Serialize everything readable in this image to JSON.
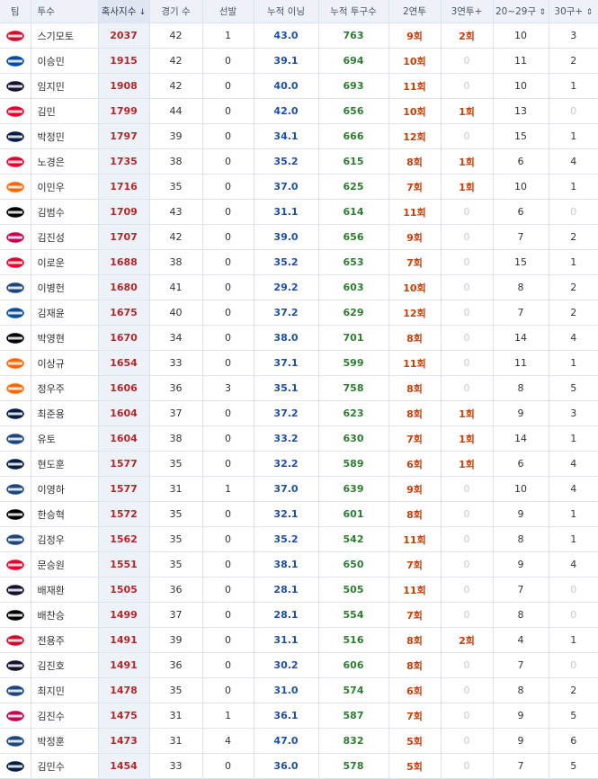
{
  "headers": [
    "팀",
    "투수",
    "혹사지수",
    "경기 수",
    "선발",
    "누적 이닝",
    "누적 투구수",
    "2연투",
    "3연투+",
    "20~29구",
    "30구+"
  ],
  "sort_arrow": "↓",
  "sortable_arrow": "⇕",
  "team_colors": {
    "SSG": "#ce0e2d",
    "LG": "#c30452",
    "NC": "#1d467f",
    "KIA": "#ea0029",
    "DOO": "#131230",
    "LOT": "#041e42",
    "HAN": "#ff6600",
    "KT": "#000000",
    "SAM": "#074ca1",
    "KIW": "#820024"
  },
  "rows": [
    {
      "team": "SSG",
      "team_label": "SSG",
      "pitcher": "스기모토",
      "strain": "2037",
      "games": "42",
      "starts": "1",
      "innings": "43.0",
      "pitches": "763",
      "two": "9회",
      "three": "2회",
      "r2029": "10",
      "r30": "3"
    },
    {
      "team": "SAM",
      "team_label": "LIONS",
      "pitcher": "이승민",
      "strain": "1915",
      "games": "42",
      "starts": "0",
      "innings": "39.1",
      "pitches": "694",
      "two": "10회",
      "three": "0",
      "r2029": "11",
      "r30": "2"
    },
    {
      "team": "DOO",
      "team_label": "TWINS",
      "pitcher": "임지민",
      "strain": "1908",
      "games": "42",
      "starts": "0",
      "innings": "40.0",
      "pitches": "693",
      "two": "11회",
      "three": "0",
      "r2029": "10",
      "r30": "1"
    },
    {
      "team": "KIA",
      "team_label": "TIGERS",
      "pitcher": "김민",
      "strain": "1799",
      "games": "44",
      "starts": "0",
      "innings": "42.0",
      "pitches": "656",
      "two": "10회",
      "three": "1회",
      "r2029": "13",
      "r30": "0"
    },
    {
      "team": "LOT",
      "team_label": "GIANTS",
      "pitcher": "박정민",
      "strain": "1797",
      "games": "39",
      "starts": "0",
      "innings": "34.1",
      "pitches": "666",
      "two": "12회",
      "three": "0",
      "r2029": "15",
      "r30": "1"
    },
    {
      "team": "KIA",
      "team_label": "TIGERS",
      "pitcher": "노경은",
      "strain": "1735",
      "games": "38",
      "starts": "0",
      "innings": "35.2",
      "pitches": "615",
      "two": "8회",
      "three": "1회",
      "r2029": "6",
      "r30": "4"
    },
    {
      "team": "HAN",
      "team_label": "EAGLES",
      "pitcher": "이민우",
      "strain": "1716",
      "games": "35",
      "starts": "0",
      "innings": "37.0",
      "pitches": "625",
      "two": "7회",
      "three": "1회",
      "r2029": "10",
      "r30": "1"
    },
    {
      "team": "KT",
      "team_label": "KT",
      "pitcher": "김범수",
      "strain": "1709",
      "games": "43",
      "starts": "0",
      "innings": "31.1",
      "pitches": "614",
      "two": "11회",
      "three": "0",
      "r2029": "6",
      "r30": "0"
    },
    {
      "team": "LG",
      "team_label": "TWINS",
      "pitcher": "김진성",
      "strain": "1707",
      "games": "42",
      "starts": "0",
      "innings": "39.0",
      "pitches": "656",
      "two": "9회",
      "three": "0",
      "r2029": "7",
      "r30": "2"
    },
    {
      "team": "KIA",
      "team_label": "TIGERS",
      "pitcher": "이로운",
      "strain": "1688",
      "games": "38",
      "starts": "0",
      "innings": "35.2",
      "pitches": "653",
      "two": "7회",
      "three": "0",
      "r2029": "15",
      "r30": "1"
    },
    {
      "team": "NC",
      "team_label": "DINOS",
      "pitcher": "이병헌",
      "strain": "1680",
      "games": "41",
      "starts": "0",
      "innings": "29.2",
      "pitches": "603",
      "two": "10회",
      "three": "0",
      "r2029": "8",
      "r30": "2"
    },
    {
      "team": "SAM",
      "team_label": "LIONS",
      "pitcher": "김재윤",
      "strain": "1675",
      "games": "40",
      "starts": "0",
      "innings": "37.2",
      "pitches": "629",
      "two": "12회",
      "three": "0",
      "r2029": "7",
      "r30": "2"
    },
    {
      "team": "KT",
      "team_label": "KT",
      "pitcher": "박영현",
      "strain": "1670",
      "games": "34",
      "starts": "0",
      "innings": "38.0",
      "pitches": "701",
      "two": "8회",
      "three": "0",
      "r2029": "14",
      "r30": "4"
    },
    {
      "team": "HAN",
      "team_label": "EAGLES",
      "pitcher": "이상규",
      "strain": "1654",
      "games": "33",
      "starts": "0",
      "innings": "37.1",
      "pitches": "599",
      "two": "11회",
      "three": "0",
      "r2029": "11",
      "r30": "1"
    },
    {
      "team": "HAN",
      "team_label": "EAGLES",
      "pitcher": "정우주",
      "strain": "1606",
      "games": "36",
      "starts": "3",
      "innings": "35.1",
      "pitches": "758",
      "two": "8회",
      "three": "0",
      "r2029": "8",
      "r30": "5"
    },
    {
      "team": "LOT",
      "team_label": "GIANTS",
      "pitcher": "최준용",
      "strain": "1604",
      "games": "37",
      "starts": "0",
      "innings": "37.2",
      "pitches": "623",
      "two": "8회",
      "three": "1회",
      "r2029": "9",
      "r30": "3"
    },
    {
      "team": "NC",
      "team_label": "DINOS",
      "pitcher": "유토",
      "strain": "1604",
      "games": "38",
      "starts": "0",
      "innings": "33.2",
      "pitches": "630",
      "two": "7회",
      "three": "1회",
      "r2029": "14",
      "r30": "1"
    },
    {
      "team": "LOT",
      "team_label": "GIANTS",
      "pitcher": "현도훈",
      "strain": "1577",
      "games": "35",
      "starts": "0",
      "innings": "32.2",
      "pitches": "589",
      "two": "6회",
      "three": "1회",
      "r2029": "6",
      "r30": "4"
    },
    {
      "team": "NC",
      "team_label": "DINOS",
      "pitcher": "이영하",
      "strain": "1577",
      "games": "31",
      "starts": "1",
      "innings": "37.0",
      "pitches": "639",
      "two": "9회",
      "three": "0",
      "r2029": "10",
      "r30": "4"
    },
    {
      "team": "KT",
      "team_label": "KT",
      "pitcher": "한승혁",
      "strain": "1572",
      "games": "35",
      "starts": "0",
      "innings": "32.1",
      "pitches": "601",
      "two": "8회",
      "three": "0",
      "r2029": "9",
      "r30": "1"
    },
    {
      "team": "NC",
      "team_label": "DINOS",
      "pitcher": "김정우",
      "strain": "1562",
      "games": "35",
      "starts": "0",
      "innings": "35.2",
      "pitches": "542",
      "two": "11회",
      "three": "0",
      "r2029": "8",
      "r30": "1"
    },
    {
      "team": "KIA",
      "team_label": "TIGERS",
      "pitcher": "문승원",
      "strain": "1551",
      "games": "35",
      "starts": "0",
      "innings": "38.1",
      "pitches": "650",
      "two": "7회",
      "three": "0",
      "r2029": "9",
      "r30": "4"
    },
    {
      "team": "DOO",
      "team_label": "TWINS",
      "pitcher": "배재환",
      "strain": "1505",
      "games": "36",
      "starts": "0",
      "innings": "28.1",
      "pitches": "505",
      "two": "11회",
      "three": "0",
      "r2029": "7",
      "r30": "0"
    },
    {
      "team": "KT",
      "team_label": "KT",
      "pitcher": "배찬승",
      "strain": "1499",
      "games": "37",
      "starts": "0",
      "innings": "28.1",
      "pitches": "554",
      "two": "7회",
      "three": "0",
      "r2029": "8",
      "r30": "0"
    },
    {
      "team": "SSG",
      "team_label": "SSG",
      "pitcher": "전용주",
      "strain": "1491",
      "games": "39",
      "starts": "0",
      "innings": "31.1",
      "pitches": "516",
      "two": "8회",
      "three": "2회",
      "r2029": "4",
      "r30": "1"
    },
    {
      "team": "DOO",
      "team_label": "TWINS",
      "pitcher": "김진호",
      "strain": "1491",
      "games": "36",
      "starts": "0",
      "innings": "30.2",
      "pitches": "606",
      "two": "8회",
      "three": "0",
      "r2029": "7",
      "r30": "0"
    },
    {
      "team": "NC",
      "team_label": "DINOS",
      "pitcher": "최지민",
      "strain": "1478",
      "games": "35",
      "starts": "0",
      "innings": "31.0",
      "pitches": "574",
      "two": "6회",
      "three": "0",
      "r2029": "8",
      "r30": "2"
    },
    {
      "team": "LG",
      "team_label": "TWINS",
      "pitcher": "김진수",
      "strain": "1475",
      "games": "31",
      "starts": "1",
      "innings": "36.1",
      "pitches": "587",
      "two": "7회",
      "three": "0",
      "r2029": "9",
      "r30": "5"
    },
    {
      "team": "NC",
      "team_label": "DINOS",
      "pitcher": "박정훈",
      "strain": "1473",
      "games": "31",
      "starts": "4",
      "innings": "47.0",
      "pitches": "832",
      "two": "5회",
      "three": "0",
      "r2029": "9",
      "r30": "6"
    },
    {
      "team": "LOT",
      "team_label": "GIANTS",
      "pitcher": "김민수",
      "strain": "1454",
      "games": "33",
      "starts": "0",
      "innings": "36.0",
      "pitches": "578",
      "two": "5회",
      "three": "0",
      "r2029": "7",
      "r30": "5"
    }
  ]
}
